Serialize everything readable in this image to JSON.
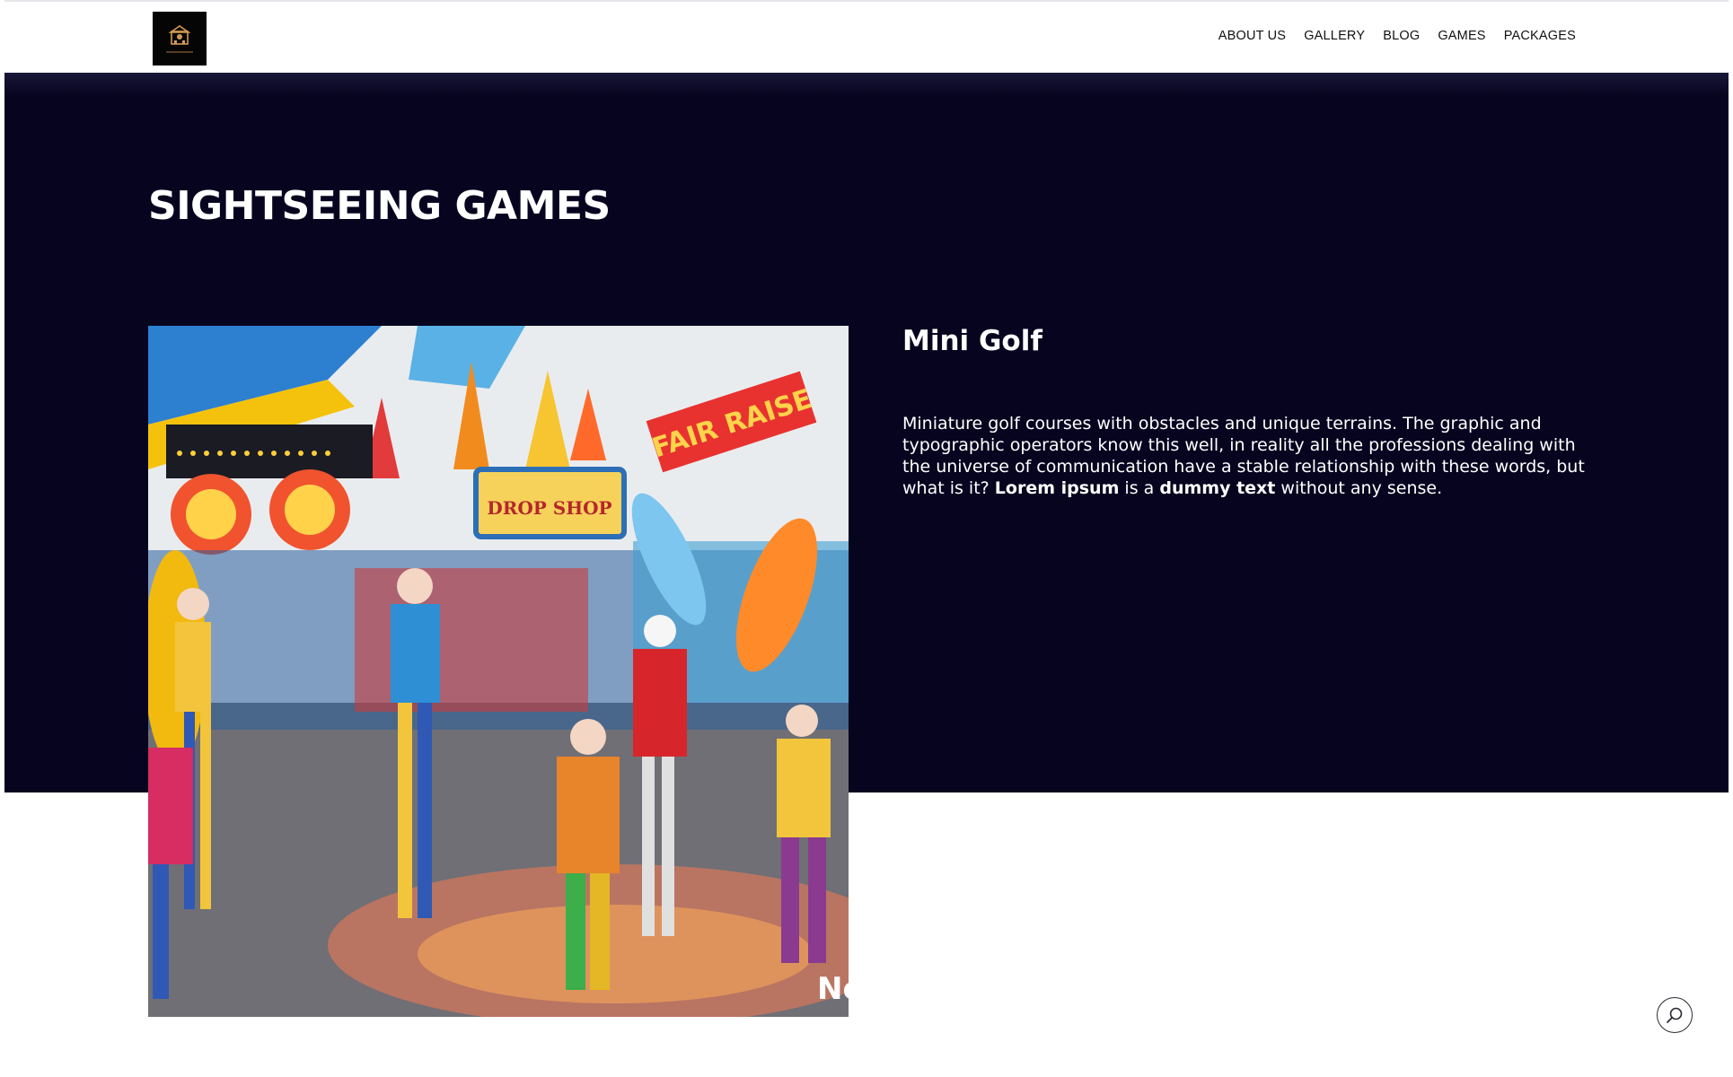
{
  "header": {
    "logo_label": "site-logo",
    "nav": [
      {
        "label": "ABOUT US"
      },
      {
        "label": "GALLERY"
      },
      {
        "label": "BLOG"
      },
      {
        "label": "GAMES"
      },
      {
        "label": "PACKAGES"
      }
    ]
  },
  "hero": {
    "title": "SIGHTSEEING GAMES"
  },
  "card": {
    "title": "Mini Golf",
    "body_intro": "Miniature golf courses with obstacles and unique terrains. The graphic and typographic operators know this well, in reality all the professions dealing with the universe of communication have a stable relationship with these words, but what is it?",
    "bold_1": "Lorem ipsum",
    "middle": "is a",
    "bold_2": "dummy text",
    "outro": "without any sense.",
    "photo_sign_1": "DROP SHOP",
    "photo_sign_2": "FAIR RAISE",
    "photo_corner": "Ne"
  },
  "icons": {
    "search": "search-icon"
  },
  "colors": {
    "hero_bg": "#06041f",
    "header_bg": "#ffffff",
    "text_light": "#ffffff",
    "nav_text": "#111111"
  }
}
